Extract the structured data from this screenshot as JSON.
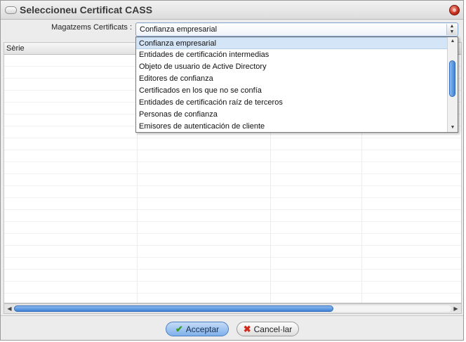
{
  "window": {
    "title": "Seleccioneu Certificat CASS",
    "close_icon": "close-icon"
  },
  "store": {
    "label": "Magatzems Certificats :",
    "selected_value": "Confianza empresarial"
  },
  "table": {
    "columns": [
      "Sèrie",
      "",
      "",
      ""
    ],
    "rows": []
  },
  "dropdown": {
    "options": [
      "Confianza empresarial",
      "Entidades de certificación intermedias",
      "Objeto de usuario de Active Directory",
      "Editores de confianza",
      "Certificados en los que no se confía",
      "Entidades de certificación raíz de terceros",
      "Personas de confianza",
      "Emisores de autenticación de cliente"
    ],
    "selected_index": 0,
    "scroll_position_fraction": 0.3
  },
  "scrollbar": {
    "horizontal_visible_fraction": 0.73
  },
  "buttons": {
    "accept_label": "Acceptar",
    "cancel_label": "Cancel·lar"
  },
  "colors": {
    "accent_blue": "#3f82d6",
    "selection_bg": "#d5e5f8",
    "close_red": "#c52b1a"
  }
}
